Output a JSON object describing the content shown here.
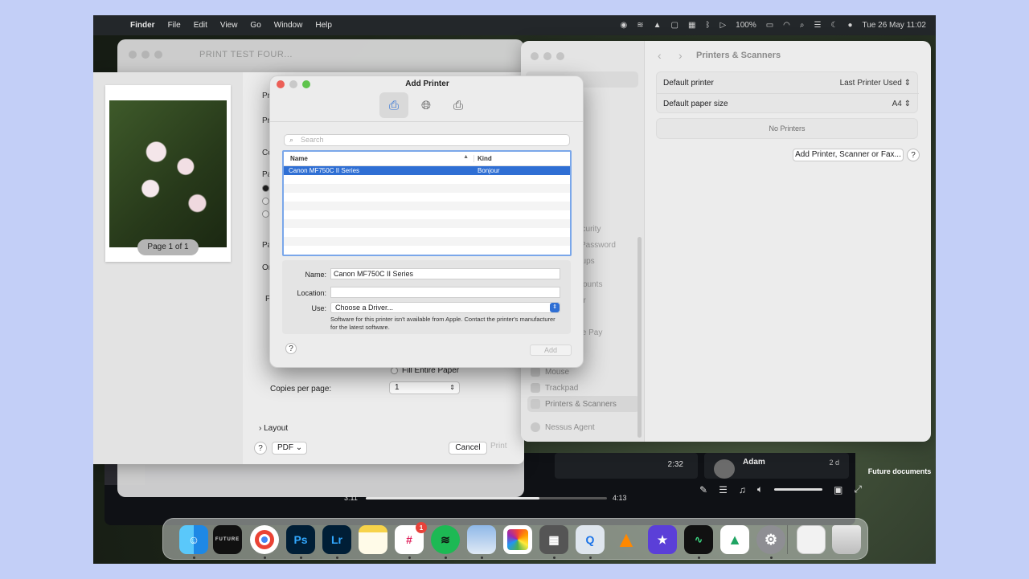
{
  "menubar": {
    "app": "Finder",
    "items": [
      "File",
      "Edit",
      "View",
      "Go",
      "Window",
      "Help"
    ],
    "battery": "100%",
    "datetime": "Tue 26 May  11:02"
  },
  "preview": {
    "title": "PRINT TEST FOUR..."
  },
  "print_dialog": {
    "page_label": "Page 1 of 1",
    "fill_entire_paper": "Fill Entire Paper",
    "copies_label": "Copies per page:",
    "copies_value": "1",
    "layout_label": "Layout",
    "pdf_label": "PDF",
    "cancel_label": "Cancel",
    "print_label": "Print",
    "stubs": [
      "Pr",
      "Pr",
      "Co",
      "Pa",
      "Pa",
      "Or",
      "P"
    ]
  },
  "settings": {
    "title": "Printers & Scanners",
    "default_printer_label": "Default printer",
    "default_printer_value": "Last Printer Used",
    "default_paper_label": "Default paper size",
    "default_paper_value": "A4",
    "no_printers": "No Printers",
    "add_button": "Add Printer, Scanner or Fax...",
    "sidebar_items": [
      "Mouse",
      "Trackpad",
      "Printers & Scanners",
      "Nessus Agent"
    ],
    "sidebar_stubs": [
      "s",
      "e",
      "n",
      "ecurity",
      "Password",
      "oups",
      "counts",
      "er",
      "ple Pay"
    ]
  },
  "add_printer": {
    "title": "Add Printer",
    "search_placeholder": "Search",
    "col_name": "Name",
    "col_kind": "Kind",
    "rows": [
      {
        "name": "Canon MF750C II Series",
        "kind": "Bonjour"
      }
    ],
    "name_label": "Name:",
    "name_value": "Canon MF750C II Series",
    "location_label": "Location:",
    "location_value": "",
    "use_label": "Use:",
    "use_value": "Choose a Driver...",
    "note": "Software for this printer isn't available from Apple. Contact the printer's manufacturer for the latest software.",
    "add_label": "Add"
  },
  "media": {
    "time_elapsed": "3:11",
    "time_total": "4:13",
    "card_time": "2:32",
    "card_name": "Adam",
    "card_age": "2 d"
  },
  "desktop": {
    "folder_label": "Future documents"
  },
  "dock": {
    "badge": "1",
    "icons": [
      "finder-icon",
      "future-icon",
      "chrome-icon",
      "photoshop-icon",
      "lightroom-icon",
      "notes-icon",
      "slack-icon",
      "spotify-icon",
      "preview-icon",
      "photos-icon",
      "screenshot-icon",
      "quicktime-icon",
      "vlc-icon",
      "imovie-icon",
      "activity-monitor-icon",
      "google-drive-icon",
      "system-settings-icon",
      "documents-icon",
      "trash-icon"
    ],
    "labels": {
      "ps": "Ps",
      "lr": "Lr",
      "future": "FUTURE"
    }
  }
}
